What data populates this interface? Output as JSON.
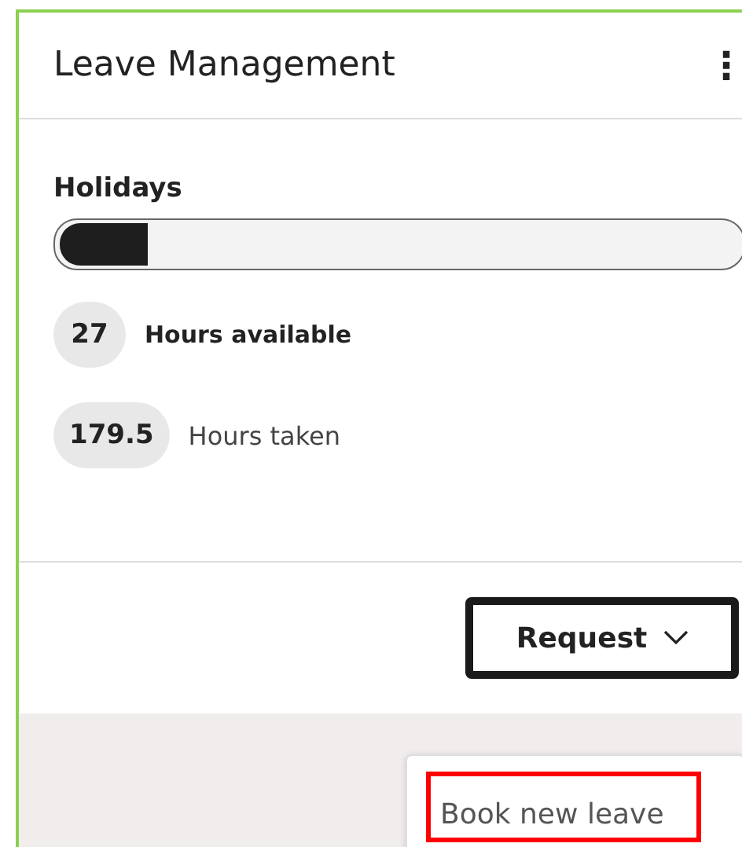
{
  "card": {
    "title": "Leave Management",
    "menu_icon": "⋮"
  },
  "holidays": {
    "label": "Holidays",
    "level": 0.13
  },
  "stats": [
    {
      "value": "27",
      "label": "Hours available",
      "emphasis": true
    },
    {
      "value": "179.5",
      "label": "Hours taken",
      "emphasis": false
    }
  ],
  "request_button": {
    "label": "Request",
    "focused": true
  },
  "dropdown": {
    "items": [
      {
        "label": "Book new leave",
        "highlighted": true
      }
    ]
  }
}
